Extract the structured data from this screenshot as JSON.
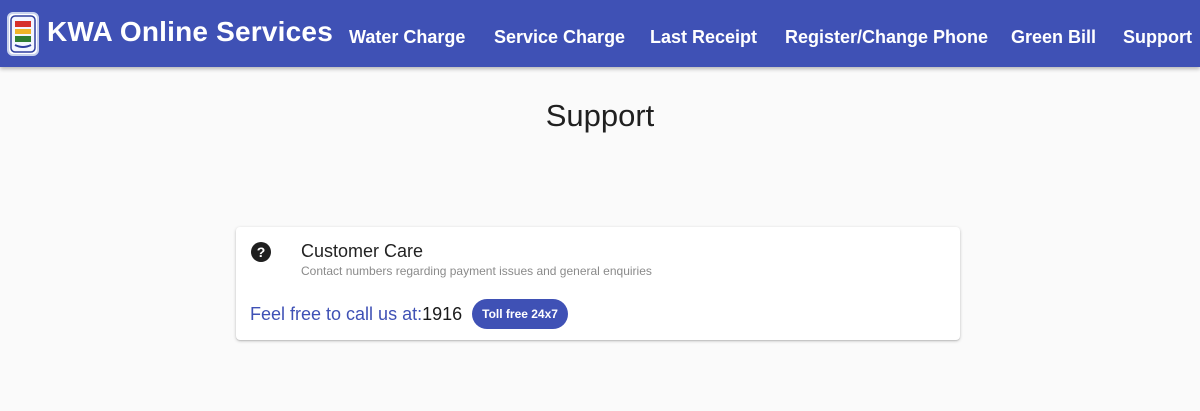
{
  "header": {
    "brand": "KWA Online Services",
    "logo_icon": "kwa-emblem-icon",
    "nav": [
      {
        "label": "Water Charge"
      },
      {
        "label": "Service Charge"
      },
      {
        "label": "Last Receipt"
      },
      {
        "label": "Register/Change Phone"
      },
      {
        "label": "Green Bill"
      },
      {
        "label": "Support",
        "active": true
      }
    ]
  },
  "page": {
    "title": "Support"
  },
  "card": {
    "icon": "help-circle-icon",
    "title": "Customer Care",
    "subtitle": "Contact numbers regarding payment issues and general enquiries",
    "call_prefix": "Feel free to call us at:",
    "phone": "1916",
    "chip": "Toll free 24x7"
  },
  "colors": {
    "primary": "#3f51b5",
    "background": "#fafafa",
    "card": "#ffffff",
    "subtitle": "#8a8a8a"
  }
}
